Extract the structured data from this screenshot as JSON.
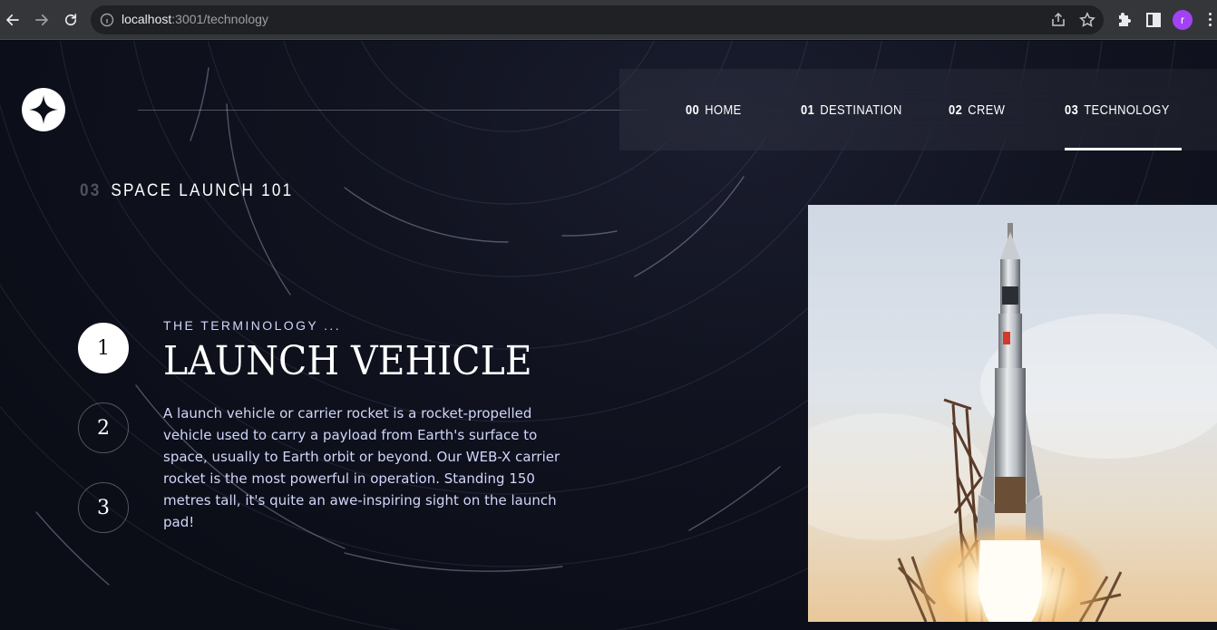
{
  "browser": {
    "url_host": "localhost",
    "url_path": ":3001/technology",
    "profile_initial": "r"
  },
  "nav": {
    "items": [
      {
        "num": "00",
        "label": "HOME"
      },
      {
        "num": "01",
        "label": "DESTINATION"
      },
      {
        "num": "02",
        "label": "CREW"
      },
      {
        "num": "03",
        "label": "TECHNOLOGY"
      }
    ],
    "active_index": 3
  },
  "heading": {
    "num": "03",
    "title": "SPACE LAUNCH 101"
  },
  "steps": [
    "1",
    "2",
    "3"
  ],
  "active_step": 0,
  "technology": {
    "label": "THE TERMINOLOGY ...",
    "name": "LAUNCH VEHICLE",
    "description": "A launch vehicle or carrier rocket is a rocket-propelled vehicle used to carry a payload from Earth's surface to space, usually to Earth orbit or beyond. Our WEB-X carrier rocket is the most powerful in operation. Standing 150 metres tall, it's quite an awe-inspiring sight on the launch pad!"
  },
  "colors": {
    "background": "#0b0d17",
    "text_light": "#d0d6f9",
    "white": "#ffffff",
    "avatar": "#a142f4"
  },
  "icons": {
    "back": "arrow-left-icon",
    "forward": "arrow-right-icon",
    "reload": "reload-icon",
    "info": "info-icon",
    "share": "share-icon",
    "bookmark": "star-icon",
    "extensions": "puzzle-icon",
    "sidebar": "side-panel-icon",
    "menu": "kebab-menu-icon",
    "logo": "four-point-star-logo"
  }
}
